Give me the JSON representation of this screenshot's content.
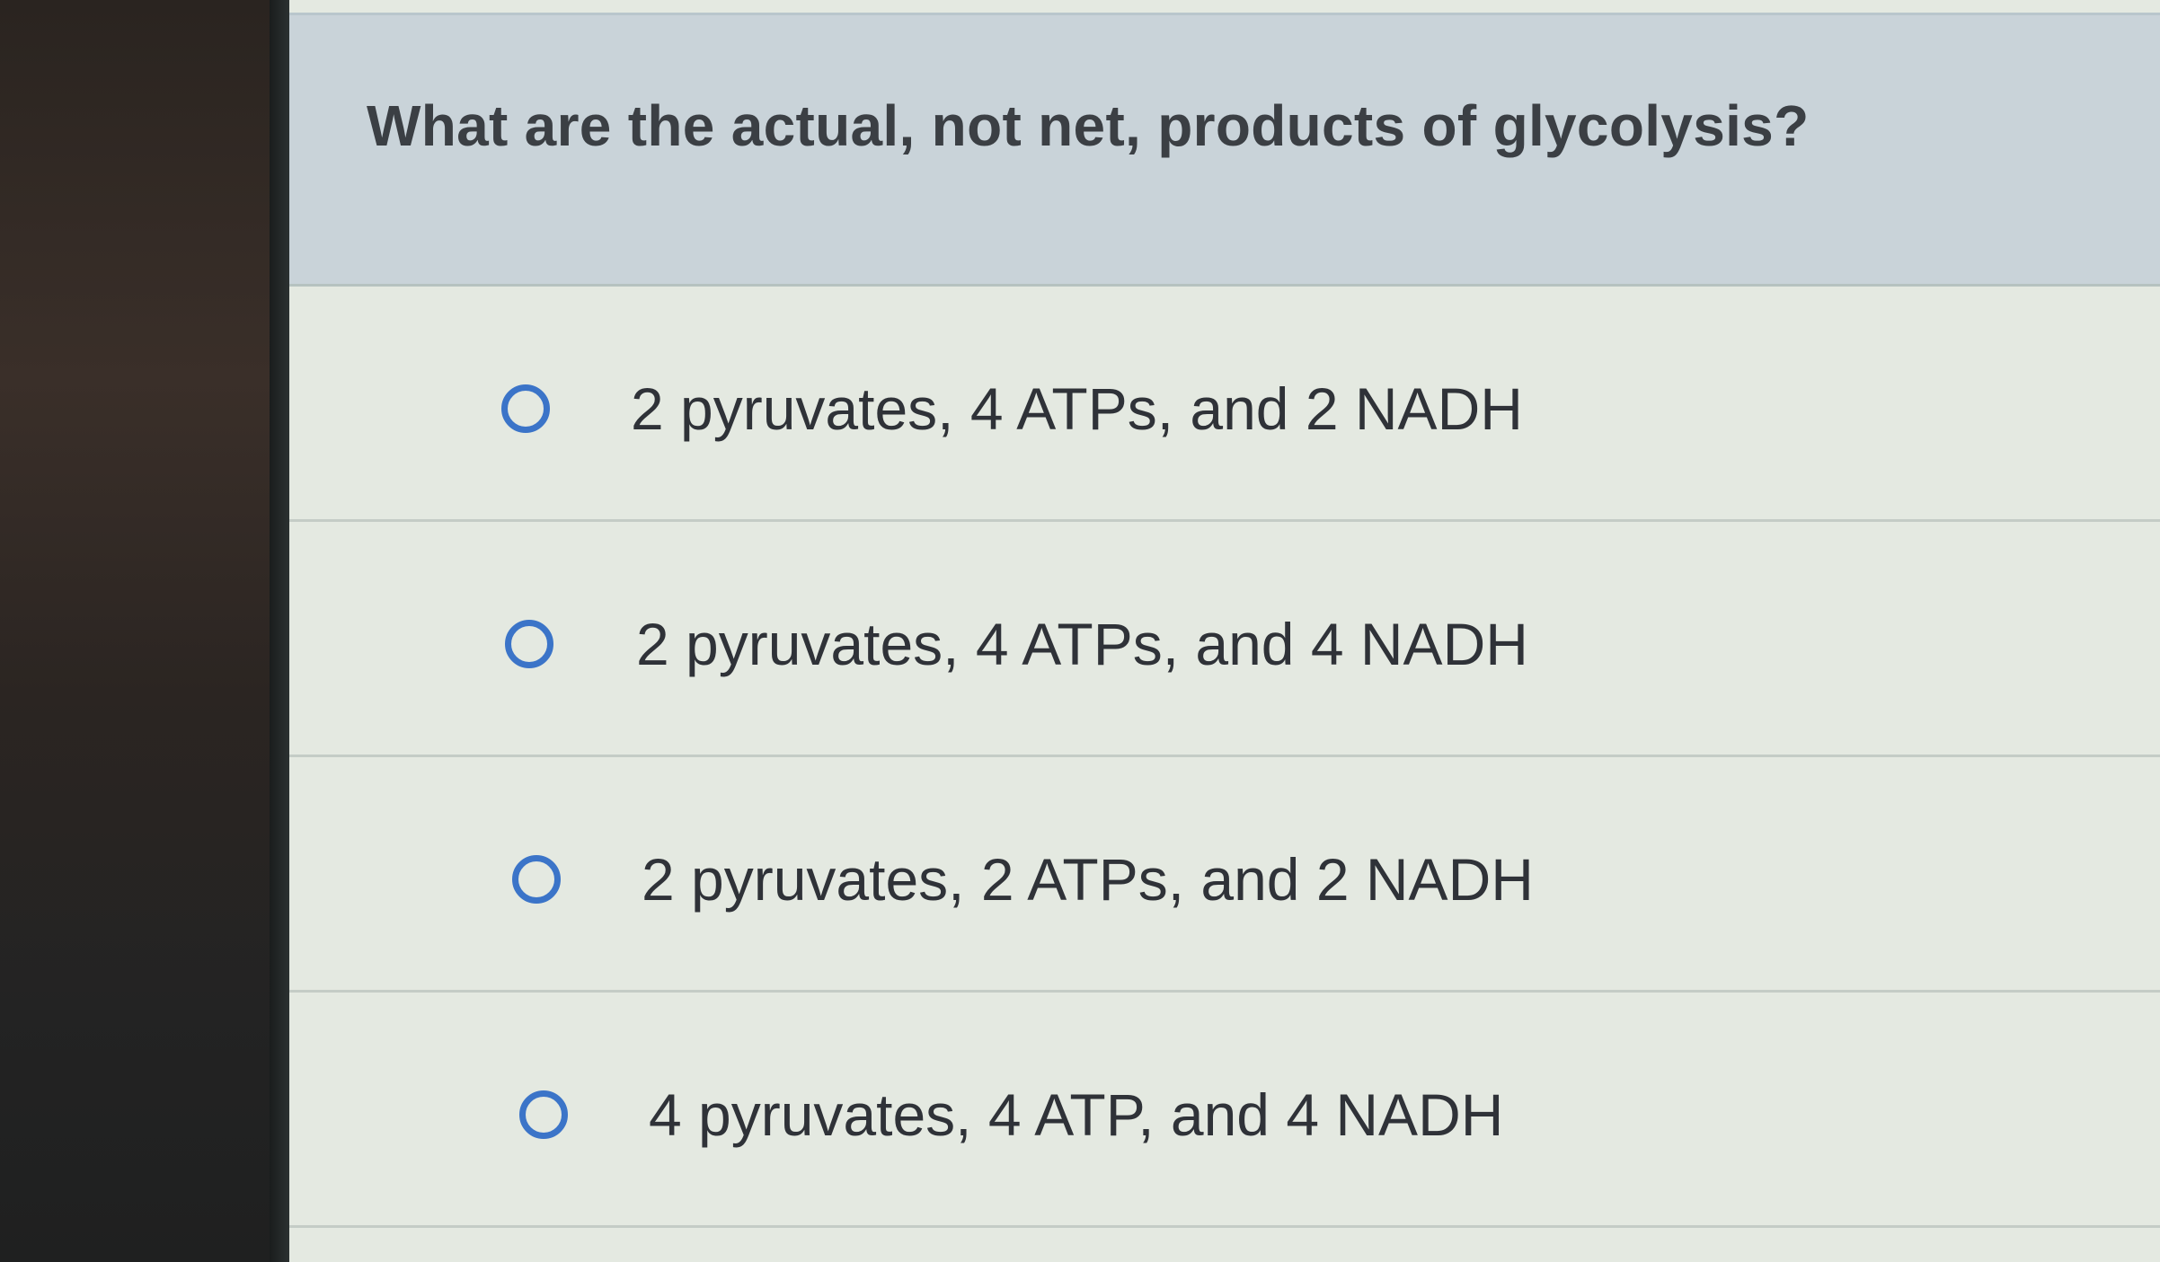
{
  "question": {
    "text": "What are the actual, not net, products of glycolysis?"
  },
  "options": [
    {
      "label": "2 pyruvates, 4 ATPs, and 2 NADH",
      "selected": false
    },
    {
      "label": "2 pyruvates, 4 ATPs, and 4 NADH",
      "selected": false
    },
    {
      "label": "2 pyruvates, 2 ATPs, and 2 NADH",
      "selected": false
    },
    {
      "label": "4 pyruvates, 4 ATP, and 4 NADH",
      "selected": false
    }
  ],
  "colors": {
    "accent": "#3b74c8",
    "question_background": "#c9d3d9",
    "options_background": "#e4e9e1"
  }
}
